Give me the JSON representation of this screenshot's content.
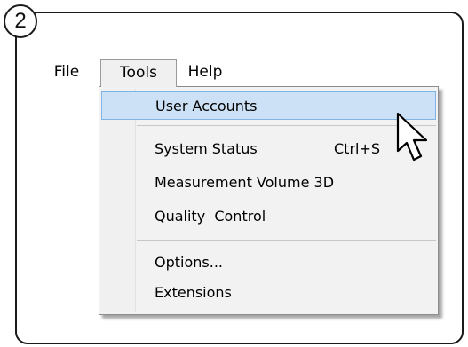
{
  "step": "2",
  "menubar": {
    "items": [
      {
        "label": "File"
      },
      {
        "label": "Tools"
      },
      {
        "label": "Help"
      }
    ]
  },
  "dropdown": {
    "items": [
      {
        "label": "User Accounts",
        "highlighted": true
      },
      {
        "label": "System Status",
        "shortcut": "Ctrl+S"
      },
      {
        "label": "Measurement Volume 3D"
      },
      {
        "label": "Quality  Control"
      },
      {
        "label": "Options..."
      },
      {
        "label": "Extensions"
      }
    ]
  },
  "colors": {
    "highlight_bg": "#cce1f5",
    "highlight_border": "#7fb4e6",
    "frame": "#1a1a1a"
  },
  "icons": {
    "cursor": "arrow-cursor-icon"
  }
}
